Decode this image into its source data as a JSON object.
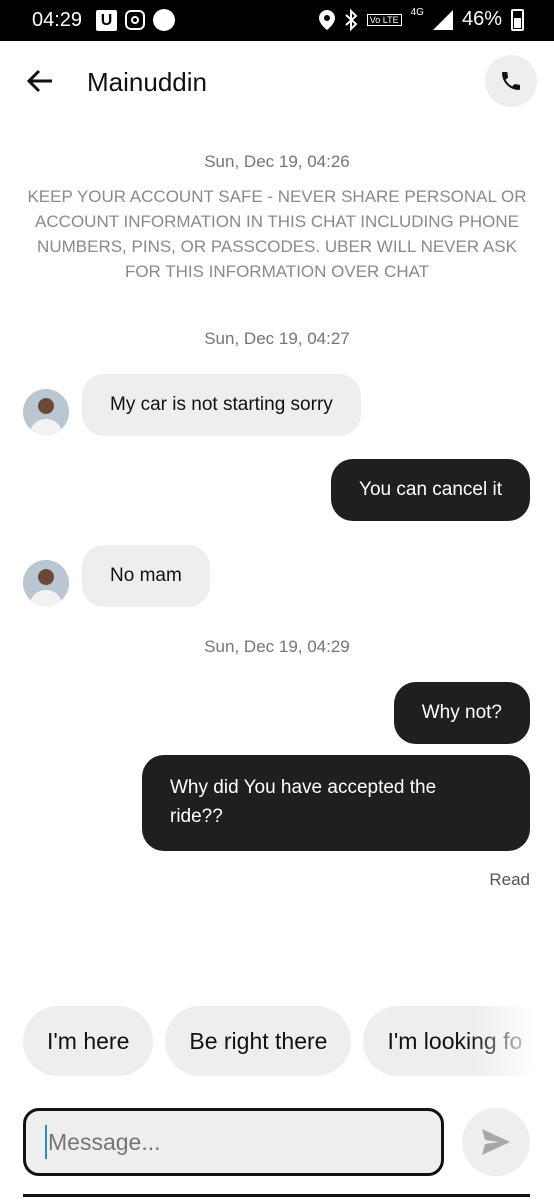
{
  "status_bar": {
    "time": "04:29",
    "battery": "46%",
    "volte": "Vo LTE",
    "network": "4G"
  },
  "header": {
    "title": "Mainuddin"
  },
  "chat": {
    "timestamp_1": "Sun, Dec 19, 04:26",
    "notice": "KEEP YOUR ACCOUNT SAFE - NEVER SHARE PERSONAL OR ACCOUNT INFORMATION IN THIS CHAT INCLUDING PHONE NUMBERS, PINS, OR PASSCODES. UBER WILL NEVER ASK FOR THIS INFORMATION OVER CHAT",
    "timestamp_2": "Sun, Dec 19, 04:27",
    "timestamp_3": "Sun, Dec 19, 04:29",
    "messages": [
      {
        "from": "driver",
        "text": "My car is not starting sorry"
      },
      {
        "from": "me",
        "text": "You can cancel it"
      },
      {
        "from": "driver",
        "text": "No mam"
      },
      {
        "from": "me",
        "text": "Why not?"
      },
      {
        "from": "me",
        "text": "Why did You have accepted the ride??"
      }
    ],
    "read_receipt": "Read"
  },
  "quick_replies": [
    "I'm here",
    "Be right there",
    "I'm looking fo"
  ],
  "composer": {
    "placeholder": "Message..."
  },
  "colors": {
    "outgoing_bubble": "#1f1f1f",
    "incoming_bubble": "#eeeeee",
    "caret": "#2a8fbd"
  }
}
